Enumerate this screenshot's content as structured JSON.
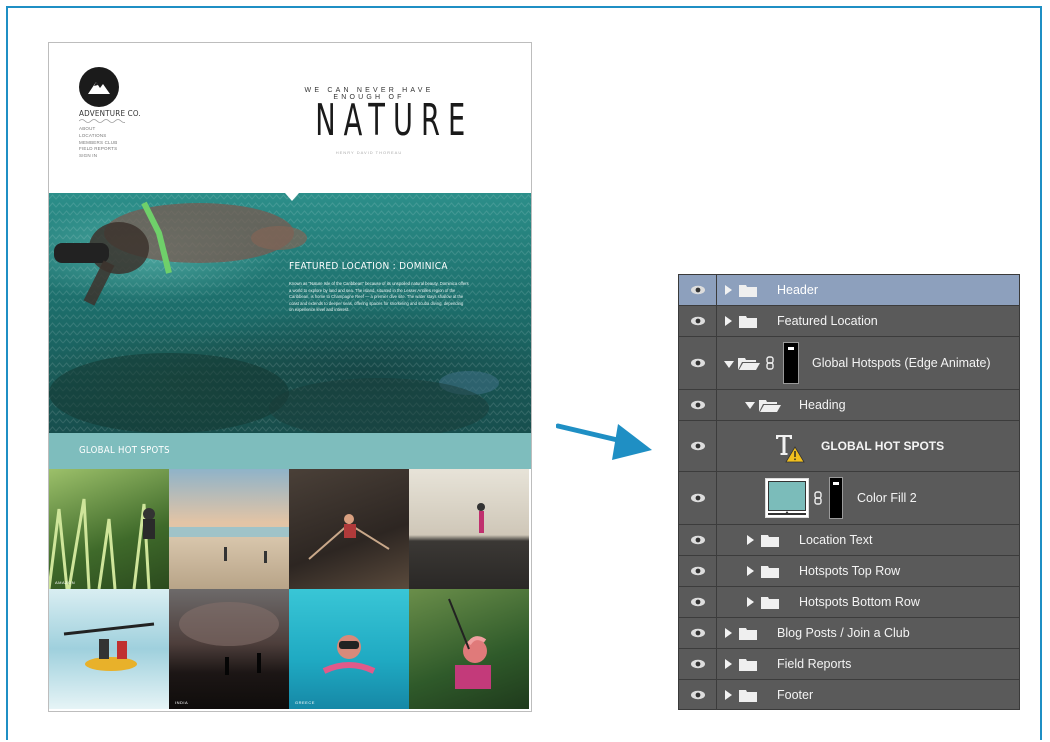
{
  "webpage": {
    "brand": "ADVENTURE CO.",
    "nav": [
      "ABOUT",
      "LOCATIONS",
      "MEMBERS CLUB",
      "FIELD REPORTS",
      "SIGN IN"
    ],
    "tagline": "WE CAN NEVER HAVE ENOUGH OF",
    "headline": "NATURE",
    "credit": "HENRY DAVID THOREAU",
    "featured_title": "FEATURED LOCATION : DOMINICA",
    "featured_text": "Known as \"Nature Isle of the Caribbean\" because of its unspoiled natural beauty, Dominica offers a world to explore by land and sea. The island, situated in the Lesser Antilles region of the Caribbean, is home to Champagne Reef — a premier dive site. The water stays shallow at the coast and extends to deeper seas, offering spaces for snorkeling and scuba diving, depending on experience level and interest.",
    "hotspots_heading": "GLOBAL HOT SPOTS",
    "tile_captions": [
      "AMAZON",
      "",
      "",
      "",
      "",
      "INDIA",
      "GREECE",
      ""
    ]
  },
  "layers_panel": {
    "rows": [
      {
        "label": "Header",
        "type": "group",
        "expanded": false,
        "indent": 0,
        "selected": true
      },
      {
        "label": "Featured Location",
        "type": "group",
        "expanded": false,
        "indent": 0,
        "selected": false
      },
      {
        "label": "Global Hotspots (Edge Animate)",
        "type": "group-masked",
        "expanded": true,
        "indent": 0,
        "selected": false
      },
      {
        "label": "Heading",
        "type": "group",
        "expanded": true,
        "indent": 1,
        "selected": false
      },
      {
        "label": "GLOBAL HOT SPOTS",
        "type": "text-warning",
        "indent": 2,
        "selected": false
      },
      {
        "label": "Color Fill 2",
        "type": "fill-masked",
        "indent": 2,
        "selected": false
      },
      {
        "label": "Location Text",
        "type": "group",
        "expanded": false,
        "indent": 1,
        "selected": false
      },
      {
        "label": "Hotspots Top Row",
        "type": "group",
        "expanded": false,
        "indent": 1,
        "selected": false
      },
      {
        "label": "Hotspots Bottom Row",
        "type": "group",
        "expanded": false,
        "indent": 1,
        "selected": false
      },
      {
        "label": "Blog Posts / Join a Club",
        "type": "group",
        "expanded": false,
        "indent": 0,
        "selected": false
      },
      {
        "label": "Field Reports",
        "type": "group",
        "expanded": false,
        "indent": 0,
        "selected": false
      },
      {
        "label": "Footer",
        "type": "group",
        "expanded": false,
        "indent": 0,
        "selected": false
      }
    ]
  },
  "colors": {
    "accent_blue": "#1f8fc4",
    "panel_bg": "#5a5a5a",
    "selected_row": "#8da0bd",
    "teal_bar": "#7ebdbd",
    "color_fill_swatch": "#7bbcba"
  },
  "icons": [
    "eye-icon",
    "folder-icon",
    "open-folder-icon",
    "chain-link-icon",
    "layer-mask-thumbnail",
    "type-layer-icon",
    "warning-icon",
    "expand-triangle-icon",
    "arrow-icon"
  ]
}
